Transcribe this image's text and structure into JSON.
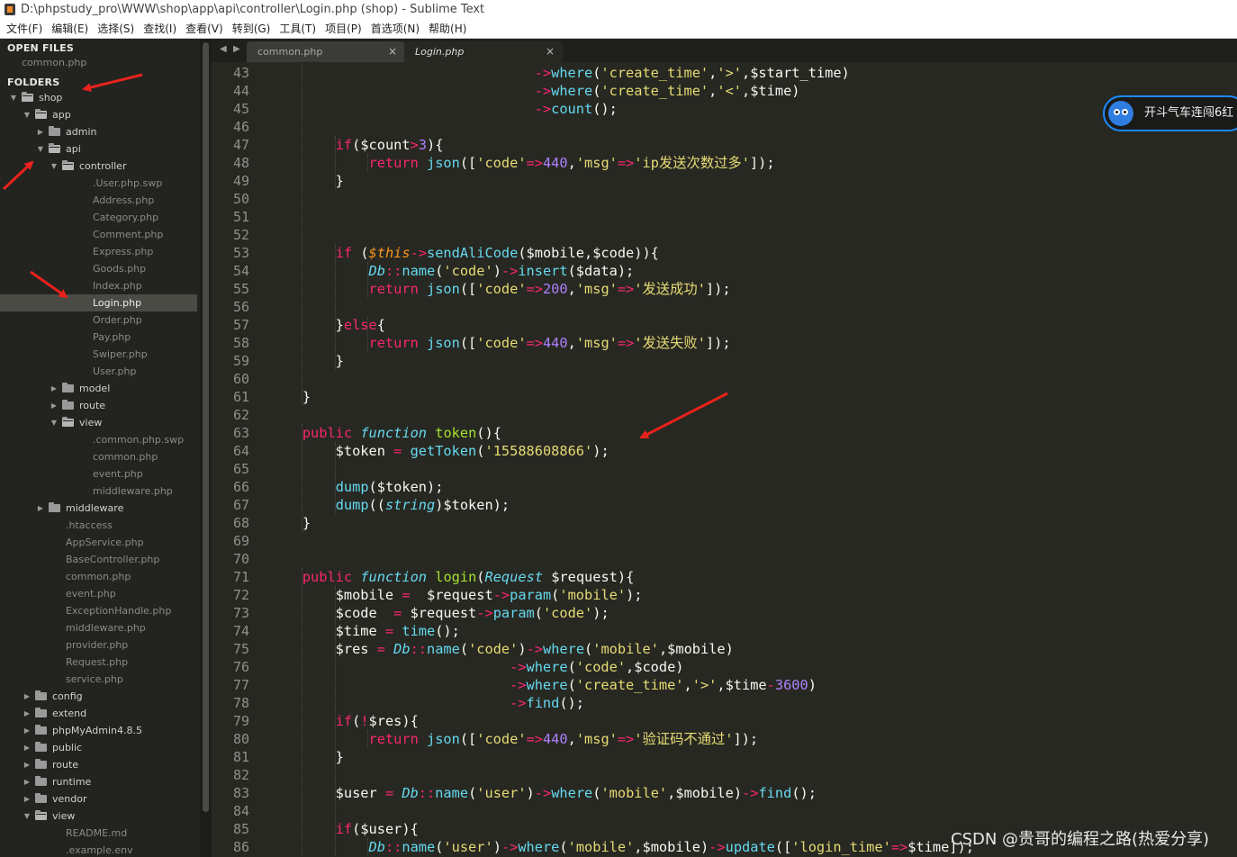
{
  "window": {
    "title": "D:\\phpstudy_pro\\WWW\\shop\\app\\api\\controller\\Login.php (shop) - Sublime Text"
  },
  "menu": [
    "文件(F)",
    "编辑(E)",
    "选择(S)",
    "查找(I)",
    "查看(V)",
    "转到(G)",
    "工具(T)",
    "项目(P)",
    "首选项(N)",
    "帮助(H)"
  ],
  "sidebar": {
    "open_files_label": "OPEN FILES",
    "open_files": [
      "common.php"
    ],
    "folders_label": "FOLDERS",
    "tree": [
      {
        "label": "shop",
        "kind": "dir",
        "open": true
      },
      {
        "label": "app",
        "kind": "dir",
        "open": true
      },
      {
        "label": "admin",
        "kind": "dir",
        "open": false
      },
      {
        "label": "api",
        "kind": "dir",
        "open": true
      },
      {
        "label": "controller",
        "kind": "dir",
        "open": true
      },
      {
        "label": ".User.php.swp",
        "kind": "file"
      },
      {
        "label": "Address.php",
        "kind": "file"
      },
      {
        "label": "Category.php",
        "kind": "file"
      },
      {
        "label": "Comment.php",
        "kind": "file"
      },
      {
        "label": "Express.php",
        "kind": "file"
      },
      {
        "label": "Goods.php",
        "kind": "file"
      },
      {
        "label": "Index.php",
        "kind": "file"
      },
      {
        "label": "Login.php",
        "kind": "file",
        "selected": true
      },
      {
        "label": "Order.php",
        "kind": "file"
      },
      {
        "label": "Pay.php",
        "kind": "file"
      },
      {
        "label": "Swiper.php",
        "kind": "file"
      },
      {
        "label": "User.php",
        "kind": "file"
      },
      {
        "label": "model",
        "kind": "dir",
        "open": false
      },
      {
        "label": "route",
        "kind": "dir",
        "open": false
      },
      {
        "label": "view",
        "kind": "dir",
        "open": true
      },
      {
        "label": ".common.php.swp",
        "kind": "file"
      },
      {
        "label": "common.php",
        "kind": "file"
      },
      {
        "label": "event.php",
        "kind": "file"
      },
      {
        "label": "middleware.php",
        "kind": "file"
      },
      {
        "label": "middleware",
        "kind": "dir",
        "open": false
      },
      {
        "label": ".htaccess",
        "kind": "file"
      },
      {
        "label": "AppService.php",
        "kind": "file"
      },
      {
        "label": "BaseController.php",
        "kind": "file"
      },
      {
        "label": "common.php",
        "kind": "file"
      },
      {
        "label": "event.php",
        "kind": "file"
      },
      {
        "label": "ExceptionHandle.php",
        "kind": "file"
      },
      {
        "label": "middleware.php",
        "kind": "file"
      },
      {
        "label": "provider.php",
        "kind": "file"
      },
      {
        "label": "Request.php",
        "kind": "file"
      },
      {
        "label": "service.php",
        "kind": "file"
      },
      {
        "label": "config",
        "kind": "dir",
        "open": false
      },
      {
        "label": "extend",
        "kind": "dir",
        "open": false
      },
      {
        "label": "phpMyAdmin4.8.5",
        "kind": "dir",
        "open": false
      },
      {
        "label": "public",
        "kind": "dir",
        "open": false
      },
      {
        "label": "route",
        "kind": "dir",
        "open": false
      },
      {
        "label": "runtime",
        "kind": "dir",
        "open": false
      },
      {
        "label": "vendor",
        "kind": "dir",
        "open": false
      },
      {
        "label": "view",
        "kind": "dir",
        "open": true
      },
      {
        "label": "README.md",
        "kind": "file"
      },
      {
        "label": ".example.env",
        "kind": "file"
      }
    ]
  },
  "tabs": {
    "nav_left": "◀",
    "nav_right": "▶",
    "items": [
      {
        "label": "common.php",
        "close": "×",
        "active": false
      },
      {
        "label": "Login.php",
        "close": "×",
        "active": true
      }
    ]
  },
  "editor": {
    "line_numbers": [
      "43",
      "44",
      "45",
      "46",
      "47",
      "48",
      "49",
      "50",
      "51",
      "52",
      "53",
      "54",
      "55",
      "56",
      "57",
      "58",
      "59",
      "60",
      "61",
      "62",
      "63",
      "64",
      "65",
      "66",
      "67",
      "68",
      "69",
      "70",
      "71",
      "72",
      "73",
      "74",
      "75",
      "76",
      "77",
      "78",
      "79",
      "80",
      "81",
      "82",
      "83",
      "84",
      "85",
      "86"
    ],
    "lines": [
      "                                ->where('create_time','>',$start_time)",
      "                                ->where('create_time','<',$time)",
      "                                ->count();",
      "",
      "        if($count>3){",
      "            return json(['code'=>440,'msg'=>'ip发送次数过多']);",
      "        }",
      "",
      "",
      "",
      "        if ($this->sendAliCode($mobile,$code)){",
      "            Db::name('code')->insert($data);",
      "            return json(['code'=>200,'msg'=>'发送成功']);",
      "",
      "        }else{",
      "            return json(['code'=>440,'msg'=>'发送失败']);",
      "        }",
      "",
      "    }",
      "",
      "    public function token(){",
      "        $token = getToken('15588608866');",
      "",
      "        dump($token);",
      "        dump((string)$token);",
      "    }",
      "",
      "",
      "    public function login(Request $request){",
      "        $mobile =  $request->param('mobile');",
      "        $code  = $request->param('code');",
      "        $time = time();",
      "        $res = Db::name('code')->where('mobile',$mobile)",
      "                             ->where('code',$code)",
      "                             ->where('create_time','>',$time-3600)",
      "                             ->find();",
      "        if(!$res){",
      "            return json(['code'=>440,'msg'=>'验证码不通过']);",
      "        }",
      "",
      "        $user = Db::name('user')->where('mobile',$mobile)->find();",
      "",
      "        if($user){",
      "            Db::name('user')->where('mobile',$mobile)->update(['login_time'=>$time]);"
    ]
  },
  "notification": {
    "text": "开斗气车连闯6红"
  },
  "watermark": "CSDN @贵哥的编程之路(热爱分享)",
  "colors": {
    "background": "#272822",
    "keyword": "#f92672",
    "string": "#e6db74",
    "function": "#66d9ef",
    "entity": "#a6e22e",
    "number": "#ae81ff",
    "annotation_arrow": "#e8221b"
  }
}
